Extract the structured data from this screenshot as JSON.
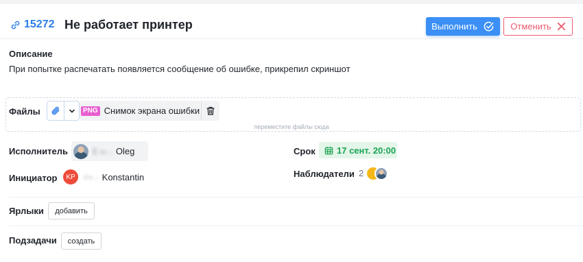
{
  "task": {
    "id": "15272",
    "title": "Не работает принтер",
    "icon": "link-icon"
  },
  "actions": {
    "complete_label": "Выполнить",
    "cancel_label": "Отменить"
  },
  "description": {
    "label": "Описание",
    "text": "При попытке распечатать появляется сообщение об ошибке, прикрепил скриншот"
  },
  "files": {
    "label": "Файлы",
    "items": [
      {
        "type": "PNG",
        "name": "Снимок экрана ошибки"
      }
    ],
    "drop_hint": "переместите файлы сюда"
  },
  "assignee": {
    "label": "Исполнитель",
    "surname_hidden": "Ε·υ·.·",
    "name": "Oleg"
  },
  "initiator": {
    "label": "Инициатор",
    "initials": "KP",
    "surname_hidden": "·i·ι·.·",
    "name": "Konstantin"
  },
  "due": {
    "label": "Срок",
    "value": "17 сент. 20:00"
  },
  "watchers": {
    "label": "Наблюдатели",
    "count": "2"
  },
  "tags": {
    "label": "Ярлыки",
    "add_label": "добавить"
  },
  "subtasks": {
    "label": "Подзадачи",
    "create_label": "создать"
  },
  "colors": {
    "accent": "#3b8ff5",
    "link": "#2b7de9",
    "danger": "#ee5a6e",
    "success": "#1aa352",
    "png_badge": "#e85fcf"
  }
}
